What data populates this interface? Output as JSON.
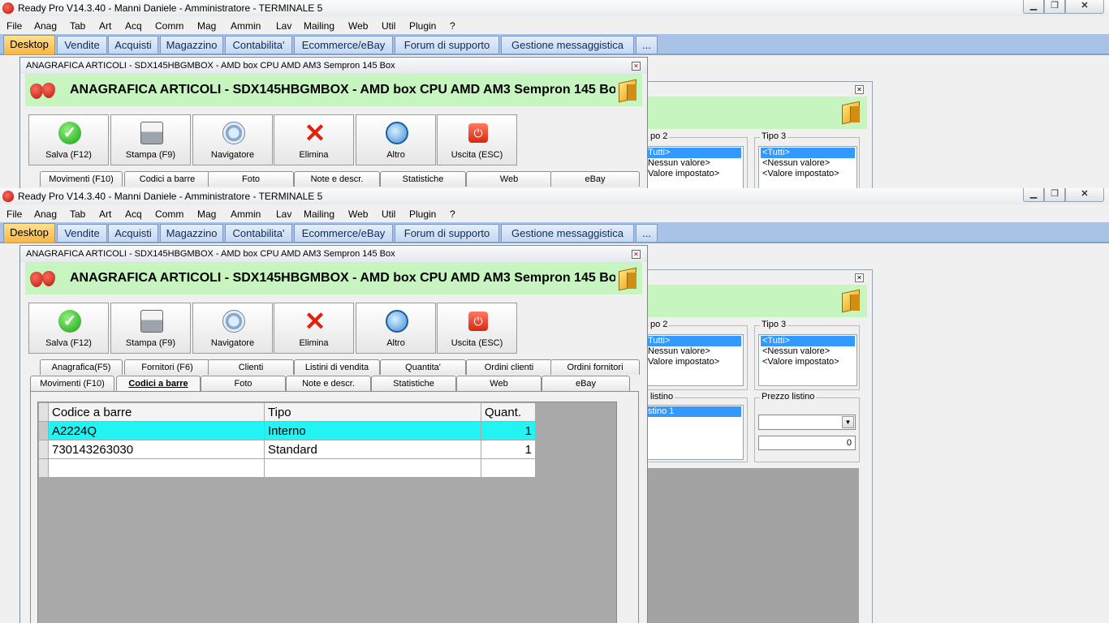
{
  "app": {
    "title": "Ready Pro V14.3.40 - Manni Daniele - Amministratore - TERMINALE 5",
    "window_buttons": {
      "minimize": "▁",
      "maximize": "❐",
      "close": "✕"
    }
  },
  "menu": [
    "File",
    "Anag",
    "Tab",
    "Art",
    "Acq",
    "Comm",
    "Mag",
    "Ammin",
    "Lav",
    "Mailing",
    "Web",
    "Util",
    "Plugin",
    "?"
  ],
  "main_tabs": [
    "Desktop",
    "Vendite",
    "Acquisti",
    "Magazzino",
    "Contabilita'",
    "Ecommerce/eBay",
    "Forum di supporto",
    "Gestione messaggistica",
    "..."
  ],
  "document": {
    "window_title": "ANAGRAFICA ARTICOLI - SDX145HBGMBOX - AMD box CPU AMD AM3 Sempron 145 Box",
    "heading_top": "ANAGRAFICA ARTICOLI - SDX145HBGMBOX - AMD box CPU AMD AM3 Sempron 145 Bo",
    "heading_bottom": "ANAGRAFICA ARTICOLI - SDX145HBGMBOX - AMD box CPU AMD AM3 Sempron 145 Bo",
    "close_glyph": "✕",
    "toolbar": [
      {
        "label": "Salva (F12)",
        "icon": "save-check-icon",
        "glyph": "✓"
      },
      {
        "label": "Stampa (F9)",
        "icon": "printer-icon",
        "glyph": ""
      },
      {
        "label": "Navigatore",
        "icon": "navigator-compass-icon",
        "glyph": ""
      },
      {
        "label": "Elimina",
        "icon": "delete-x-icon",
        "glyph": "✕"
      },
      {
        "label": "Altro",
        "icon": "magnifier-icon",
        "glyph": ""
      },
      {
        "label": "Uscita (ESC)",
        "icon": "exit-power-icon",
        "glyph": "⏻"
      }
    ],
    "tabs_row1": [
      "Anagrafica(F5)",
      "Fornitori (F6)",
      "Clienti",
      "Listini di vendita",
      "Quantita'",
      "Ordini clienti",
      "Ordini fornitori"
    ],
    "tabs_row2": [
      "Movimenti (F10)",
      "Codici a barre",
      "Foto",
      "Note e descr.",
      "Statistiche",
      "Web",
      "eBay"
    ],
    "active_tab": "Codici a barre",
    "grid": {
      "columns": [
        "Codice a barre",
        "Tipo",
        "Quant."
      ],
      "rows": [
        {
          "code": "A2224Q",
          "tipo": "Interno",
          "quant": "1"
        },
        {
          "code": "730143263030",
          "tipo": "Standard",
          "quant": "1"
        },
        {
          "code": "",
          "tipo": "",
          "quant": ""
        }
      ]
    }
  },
  "background_window": {
    "close_glyph": "✕",
    "tipo2": {
      "title": "po 2",
      "items": [
        "Tutti>",
        "Nessun valore>",
        "Valore impostato>"
      ]
    },
    "tipo3": {
      "title": "Tipo 3",
      "items": [
        "<Tutti>",
        "<Nessun valore>",
        "<Valore impostato>"
      ]
    },
    "listino": {
      "title": "listino",
      "items": [
        "stino 1"
      ]
    },
    "prezzo_listino": {
      "title": "Prezzo listino",
      "value": "0",
      "combo_arrow": "▼"
    }
  },
  "colors": {
    "tab_active": "#f7b643",
    "tab_strip": "#a9c3e6",
    "header_green": "#c6f5bf",
    "grid_highlight": "#22f3f3"
  }
}
